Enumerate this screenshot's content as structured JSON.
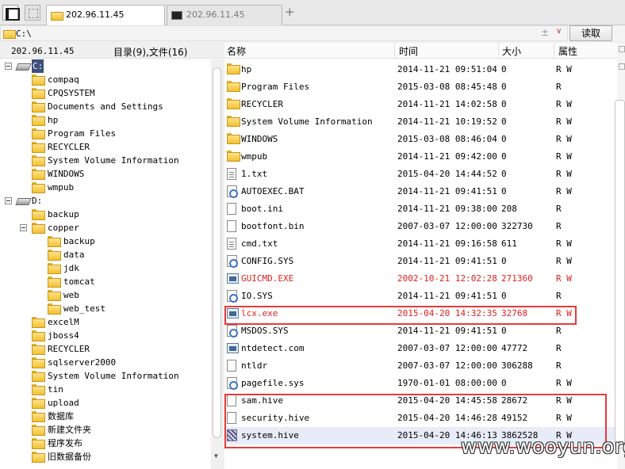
{
  "tabs": [
    {
      "label": "202.96.11.45",
      "icon": "folder-icon",
      "active": true
    },
    {
      "label": "202.96.11.45",
      "icon": "terminal-icon",
      "active": false
    }
  ],
  "address": {
    "path": "C:\\",
    "add_symbol": "±",
    "dropdown_symbol": "∨",
    "read_button": "读取"
  },
  "left_panel": {
    "host": "202.96.11.45",
    "counts": "目录(9),文件(16)",
    "tree": [
      {
        "label": "C:",
        "type": "drive",
        "level": 0,
        "selected": true
      },
      {
        "label": "compaq",
        "type": "folder",
        "level": 1
      },
      {
        "label": "CPQSYSTEM",
        "type": "folder",
        "level": 1
      },
      {
        "label": "Documents and Settings",
        "type": "folder",
        "level": 1
      },
      {
        "label": "hp",
        "type": "folder",
        "level": 1
      },
      {
        "label": "Program Files",
        "type": "folder",
        "level": 1
      },
      {
        "label": "RECYCLER",
        "type": "folder",
        "level": 1
      },
      {
        "label": "System Volume Information",
        "type": "folder",
        "level": 1
      },
      {
        "label": "WINDOWS",
        "type": "folder",
        "level": 1
      },
      {
        "label": "wmpub",
        "type": "folder",
        "level": 1
      },
      {
        "label": "D:",
        "type": "drive",
        "level": 0,
        "selected": false
      },
      {
        "label": "backup",
        "type": "folder",
        "level": 1
      },
      {
        "label": "copper",
        "type": "folder",
        "level": 1,
        "expanded": true
      },
      {
        "label": "backup",
        "type": "folder",
        "level": 2
      },
      {
        "label": "data",
        "type": "folder",
        "level": 2
      },
      {
        "label": "jdk",
        "type": "folder",
        "level": 2
      },
      {
        "label": "tomcat",
        "type": "folder",
        "level": 2
      },
      {
        "label": "web",
        "type": "folder",
        "level": 2
      },
      {
        "label": "web_test",
        "type": "folder",
        "level": 2
      },
      {
        "label": "excelM",
        "type": "folder",
        "level": 1
      },
      {
        "label": "jboss4",
        "type": "folder",
        "level": 1
      },
      {
        "label": "RECYCLER",
        "type": "folder",
        "level": 1
      },
      {
        "label": "sqlserver2000",
        "type": "folder",
        "level": 1
      },
      {
        "label": "System Volume Information",
        "type": "folder",
        "level": 1
      },
      {
        "label": "tin",
        "type": "folder",
        "level": 1
      },
      {
        "label": "upload",
        "type": "folder",
        "level": 1
      },
      {
        "label": "数据库",
        "type": "folder",
        "level": 1
      },
      {
        "label": "新建文件夹",
        "type": "folder",
        "level": 1
      },
      {
        "label": "程序发布",
        "type": "folder",
        "level": 1
      },
      {
        "label": "旧数据备份",
        "type": "folder",
        "level": 1
      }
    ]
  },
  "file_list": {
    "columns": {
      "name": "名称",
      "time": "时间",
      "size": "大小",
      "attr": "属性"
    },
    "rows": [
      {
        "name": "hp",
        "time": "2014-11-21 09:51:04",
        "size": "0",
        "attr": "R W",
        "icon": "folder-icon"
      },
      {
        "name": "Program Files",
        "time": "2015-03-08 08:45:48",
        "size": "0",
        "attr": "R",
        "icon": "folder-icon"
      },
      {
        "name": "RECYCLER",
        "time": "2014-11-21 14:02:58",
        "size": "0",
        "attr": "R W",
        "icon": "folder-icon"
      },
      {
        "name": "System Volume Information",
        "time": "2014-11-21 10:19:52",
        "size": "0",
        "attr": "R W",
        "icon": "folder-icon"
      },
      {
        "name": "WINDOWS",
        "time": "2015-03-08 08:46:04",
        "size": "0",
        "attr": "R W",
        "icon": "folder-icon"
      },
      {
        "name": "wmpub",
        "time": "2014-11-21 09:42:00",
        "size": "0",
        "attr": "R W",
        "icon": "folder-icon"
      },
      {
        "name": "1.txt",
        "time": "2015-04-20 14:44:52",
        "size": "0",
        "attr": "R W",
        "icon": "text-file-icon"
      },
      {
        "name": "AUTOEXEC.BAT",
        "time": "2014-11-21 09:41:51",
        "size": "0",
        "attr": "R W",
        "icon": "system-file-icon"
      },
      {
        "name": "boot.ini",
        "time": "2014-11-21 09:38:00",
        "size": "208",
        "attr": "R",
        "icon": "file-icon"
      },
      {
        "name": "bootfont.bin",
        "time": "2007-03-07 12:00:00",
        "size": "322730",
        "attr": "R",
        "icon": "file-icon"
      },
      {
        "name": "cmd.txt",
        "time": "2014-11-21 09:16:58",
        "size": "611",
        "attr": "R W",
        "icon": "text-file-icon"
      },
      {
        "name": "CONFIG.SYS",
        "time": "2014-11-21 09:41:51",
        "size": "0",
        "attr": "R W",
        "icon": "system-file-icon"
      },
      {
        "name": "GUICMD.EXE",
        "time": "2002-10-21 12:02:28",
        "size": "271360",
        "attr": "R W",
        "icon": "executable-icon",
        "red": true
      },
      {
        "name": "IO.SYS",
        "time": "2014-11-21 09:41:51",
        "size": "0",
        "attr": "R",
        "icon": "system-file-icon"
      },
      {
        "name": "lcx.exe",
        "time": "2015-04-20 14:32:35",
        "size": "32768",
        "attr": "R W",
        "icon": "executable-icon",
        "red": true
      },
      {
        "name": "MSDOS.SYS",
        "time": "2014-11-21 09:41:51",
        "size": "0",
        "attr": "R",
        "icon": "system-file-icon"
      },
      {
        "name": "ntdetect.com",
        "time": "2007-03-07 12:00:00",
        "size": "47772",
        "attr": "R",
        "icon": "executable-icon"
      },
      {
        "name": "ntldr",
        "time": "2007-03-07 12:00:00",
        "size": "306288",
        "attr": "R",
        "icon": "file-icon"
      },
      {
        "name": "pagefile.sys",
        "time": "1970-01-01 08:00:00",
        "size": "0",
        "attr": "R W",
        "icon": "system-file-icon"
      },
      {
        "name": "sam.hive",
        "time": "2015-04-20 14:45:58",
        "size": "28672",
        "attr": "R W",
        "icon": "file-icon"
      },
      {
        "name": "security.hive",
        "time": "2015-04-20 14:46:28",
        "size": "49152",
        "attr": "R W",
        "icon": "file-icon"
      },
      {
        "name": "system.hive",
        "time": "2015-04-20 14:46:13",
        "size": "3862528",
        "attr": "R W",
        "icon": "hive-file-icon",
        "selected": true
      }
    ]
  },
  "watermark": "www.wooyun.org",
  "colors": {
    "highlight_red": "#e83a3a",
    "red_text": "#e02020",
    "selection": "#e8ecf8",
    "drive_selected": "#3d4f7a"
  }
}
